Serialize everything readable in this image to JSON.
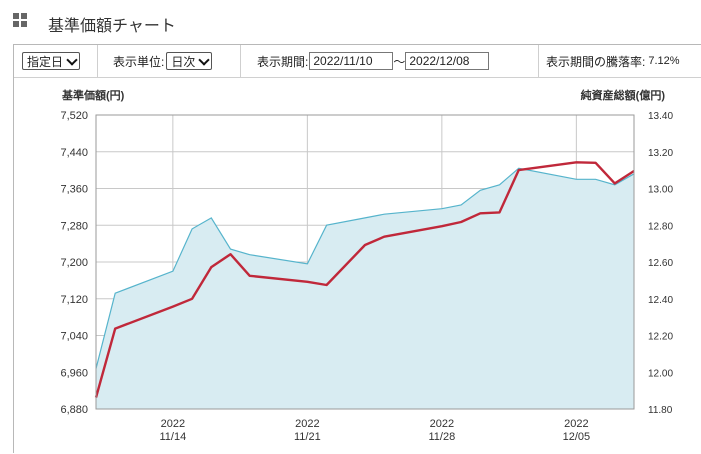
{
  "header": {
    "title": "基準価額チャート",
    "icon": "grid-icon"
  },
  "toolbar": {
    "date_select": "指定日",
    "unit_label": "表示単位:",
    "unit_select": "日次",
    "period_label": "表示期間:",
    "period_start": "2022/11/10",
    "period_sep": "〜",
    "period_end": "2022/12/08",
    "change_label": "表示期間の騰落率:",
    "change_value": "7.12%"
  },
  "chart_data": {
    "type": "line",
    "left_axis": {
      "label": "基準価額(円)",
      "ticks": [
        "7,520",
        "7,440",
        "7,360",
        "7,280",
        "7,200",
        "7,120",
        "7,040",
        "6,960",
        "6,880"
      ],
      "range": [
        6880,
        7520
      ]
    },
    "right_axis": {
      "label": "純資産総額(億円)",
      "ticks": [
        "13.40",
        "13.20",
        "13.00",
        "12.80",
        "12.60",
        "12.40",
        "12.20",
        "12.00",
        "11.80"
      ],
      "range": [
        11.8,
        13.4
      ]
    },
    "x_ticks": [
      {
        "date": "2022-11-14",
        "year": "2022",
        "day": "11/14"
      },
      {
        "date": "2022-11-21",
        "year": "2022",
        "day": "11/21"
      },
      {
        "date": "2022-11-28",
        "year": "2022",
        "day": "11/28"
      },
      {
        "date": "2022-12-05",
        "year": "2022",
        "day": "12/05"
      }
    ],
    "x_range": [
      "2022-11-10",
      "2022-12-08"
    ],
    "grid": true,
    "colors": {
      "nav_line": "#c0283a",
      "assets_fill": "#d8ecf2",
      "assets_line": "#56b4cc",
      "grid": "#c8c8c8"
    },
    "series": [
      {
        "type": "line",
        "axis": "left",
        "x": [
          "2022-11-10",
          "2022-11-11",
          "2022-11-14",
          "2022-11-15",
          "2022-11-16",
          "2022-11-17",
          "2022-11-18",
          "2022-11-21",
          "2022-11-22",
          "2022-11-24",
          "2022-11-25",
          "2022-11-28",
          "2022-11-29",
          "2022-11-30",
          "2022-12-01",
          "2022-12-02",
          "2022-12-05",
          "2022-12-06",
          "2022-12-07",
          "2022-12-08"
        ],
        "values": [
          6905,
          7055,
          7103,
          7120,
          7189,
          7217,
          7170,
          7157,
          7150,
          7237,
          7255,
          7278,
          7287,
          7306,
          7308,
          7400,
          7417,
          7416,
          7371,
          7398
        ]
      },
      {
        "type": "area",
        "axis": "right",
        "x": [
          "2022-11-10",
          "2022-11-11",
          "2022-11-14",
          "2022-11-15",
          "2022-11-16",
          "2022-11-17",
          "2022-11-18",
          "2022-11-21",
          "2022-11-22",
          "2022-11-24",
          "2022-11-25",
          "2022-11-28",
          "2022-11-29",
          "2022-11-30",
          "2022-12-01",
          "2022-12-02",
          "2022-12-05",
          "2022-12-06",
          "2022-12-07",
          "2022-12-08"
        ],
        "values": [
          12.02,
          12.43,
          12.55,
          12.78,
          12.84,
          12.67,
          12.64,
          12.59,
          12.8,
          12.84,
          12.86,
          12.89,
          12.91,
          12.99,
          13.02,
          13.11,
          13.05,
          13.05,
          13.02,
          13.08
        ]
      }
    ]
  }
}
